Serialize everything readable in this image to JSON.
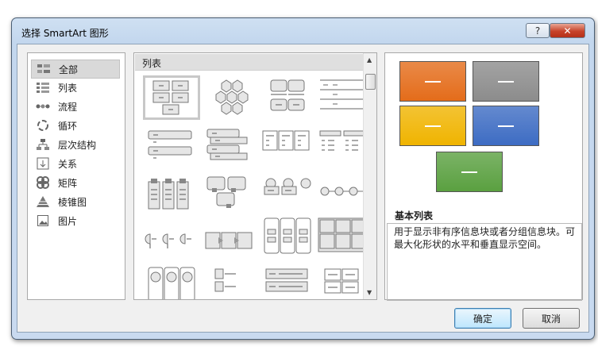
{
  "window": {
    "title": "选择 SmartArt 图形",
    "help_label": "?",
    "close_label": "✕"
  },
  "categories": [
    {
      "label": "全部",
      "icon": "all-icon",
      "selected": true
    },
    {
      "label": "列表",
      "icon": "list-icon"
    },
    {
      "label": "流程",
      "icon": "process-icon"
    },
    {
      "label": "循环",
      "icon": "cycle-icon"
    },
    {
      "label": "层次结构",
      "icon": "hierarchy-icon"
    },
    {
      "label": "关系",
      "icon": "relationship-icon"
    },
    {
      "label": "矩阵",
      "icon": "matrix-icon"
    },
    {
      "label": "棱锥图",
      "icon": "pyramid-icon"
    },
    {
      "label": "图片",
      "icon": "picture-icon"
    }
  ],
  "gallery": {
    "header": "列表"
  },
  "preview": {
    "title": "基本列表",
    "description": "用于显示非有序信息块或者分组信息块。可最大化形状的水平和垂直显示空间。",
    "colors": [
      "#e46c1a",
      "#8c8c8c",
      "#f0b400",
      "#3d6cc3",
      "#5aa040"
    ]
  },
  "buttons": {
    "ok": "确定",
    "cancel": "取消"
  }
}
